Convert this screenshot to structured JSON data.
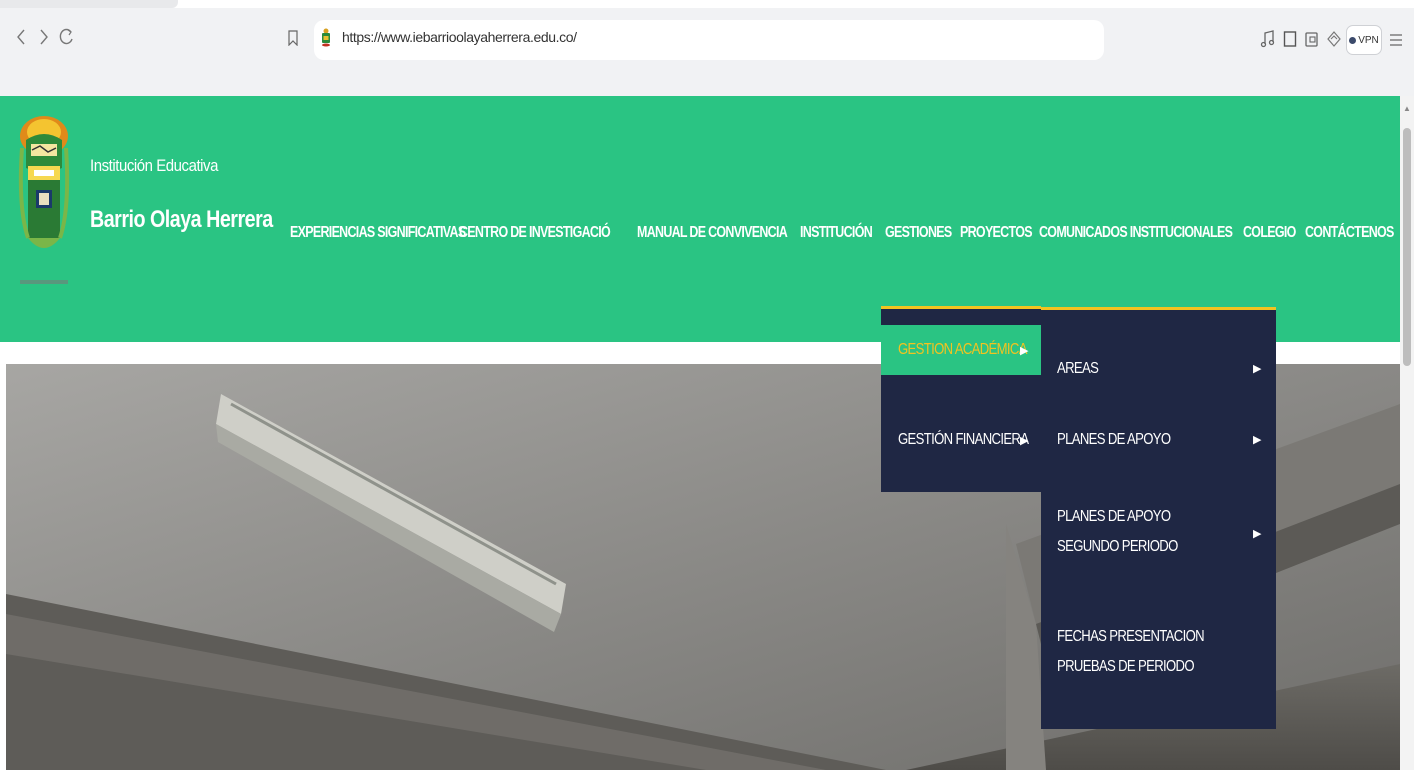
{
  "browser": {
    "url": "https://www.iebarrioolayaherrera.edu.co/",
    "vpn_label": "VPN",
    "icons": [
      "back-icon",
      "forward-icon",
      "reload-icon",
      "bookmark-icon",
      "site-favicon",
      "music-icon",
      "sidebar-icon",
      "wallet-icon",
      "extensions-icon",
      "menu-icon"
    ]
  },
  "site": {
    "institution_small": "Institución Educativa",
    "institution_name": "Barrio Olaya Herrera",
    "nav": [
      "EXPERIENCIAS SIGNIFICATIVAS",
      "CENTRO DE INVESTIGACIÓ",
      "MANUAL DE CONVIVENCIA",
      "INSTITUCIÓN",
      "GESTIONES",
      "PROYECTOS",
      "COMUNICADOS INSTITUCIONALES",
      "COLEGIO",
      "CONTÁCTENOS"
    ],
    "gestiones_menu": [
      {
        "label": "GESTION ACADÉMICA",
        "active": true
      },
      {
        "label": "GESTIÓN FINANCIERA",
        "active": false
      }
    ],
    "academica_submenu": [
      "AREAS",
      "PLANES DE APOYO",
      "PLANES DE APOYO SEGUNDO PERIODO",
      "FECHAS PRESENTACION PRUEBAS DE PERIODO"
    ]
  },
  "colors": {
    "header_green": "#2ac483",
    "dropdown_navy": "#1f2744",
    "accent_yellow": "#f2c320"
  }
}
